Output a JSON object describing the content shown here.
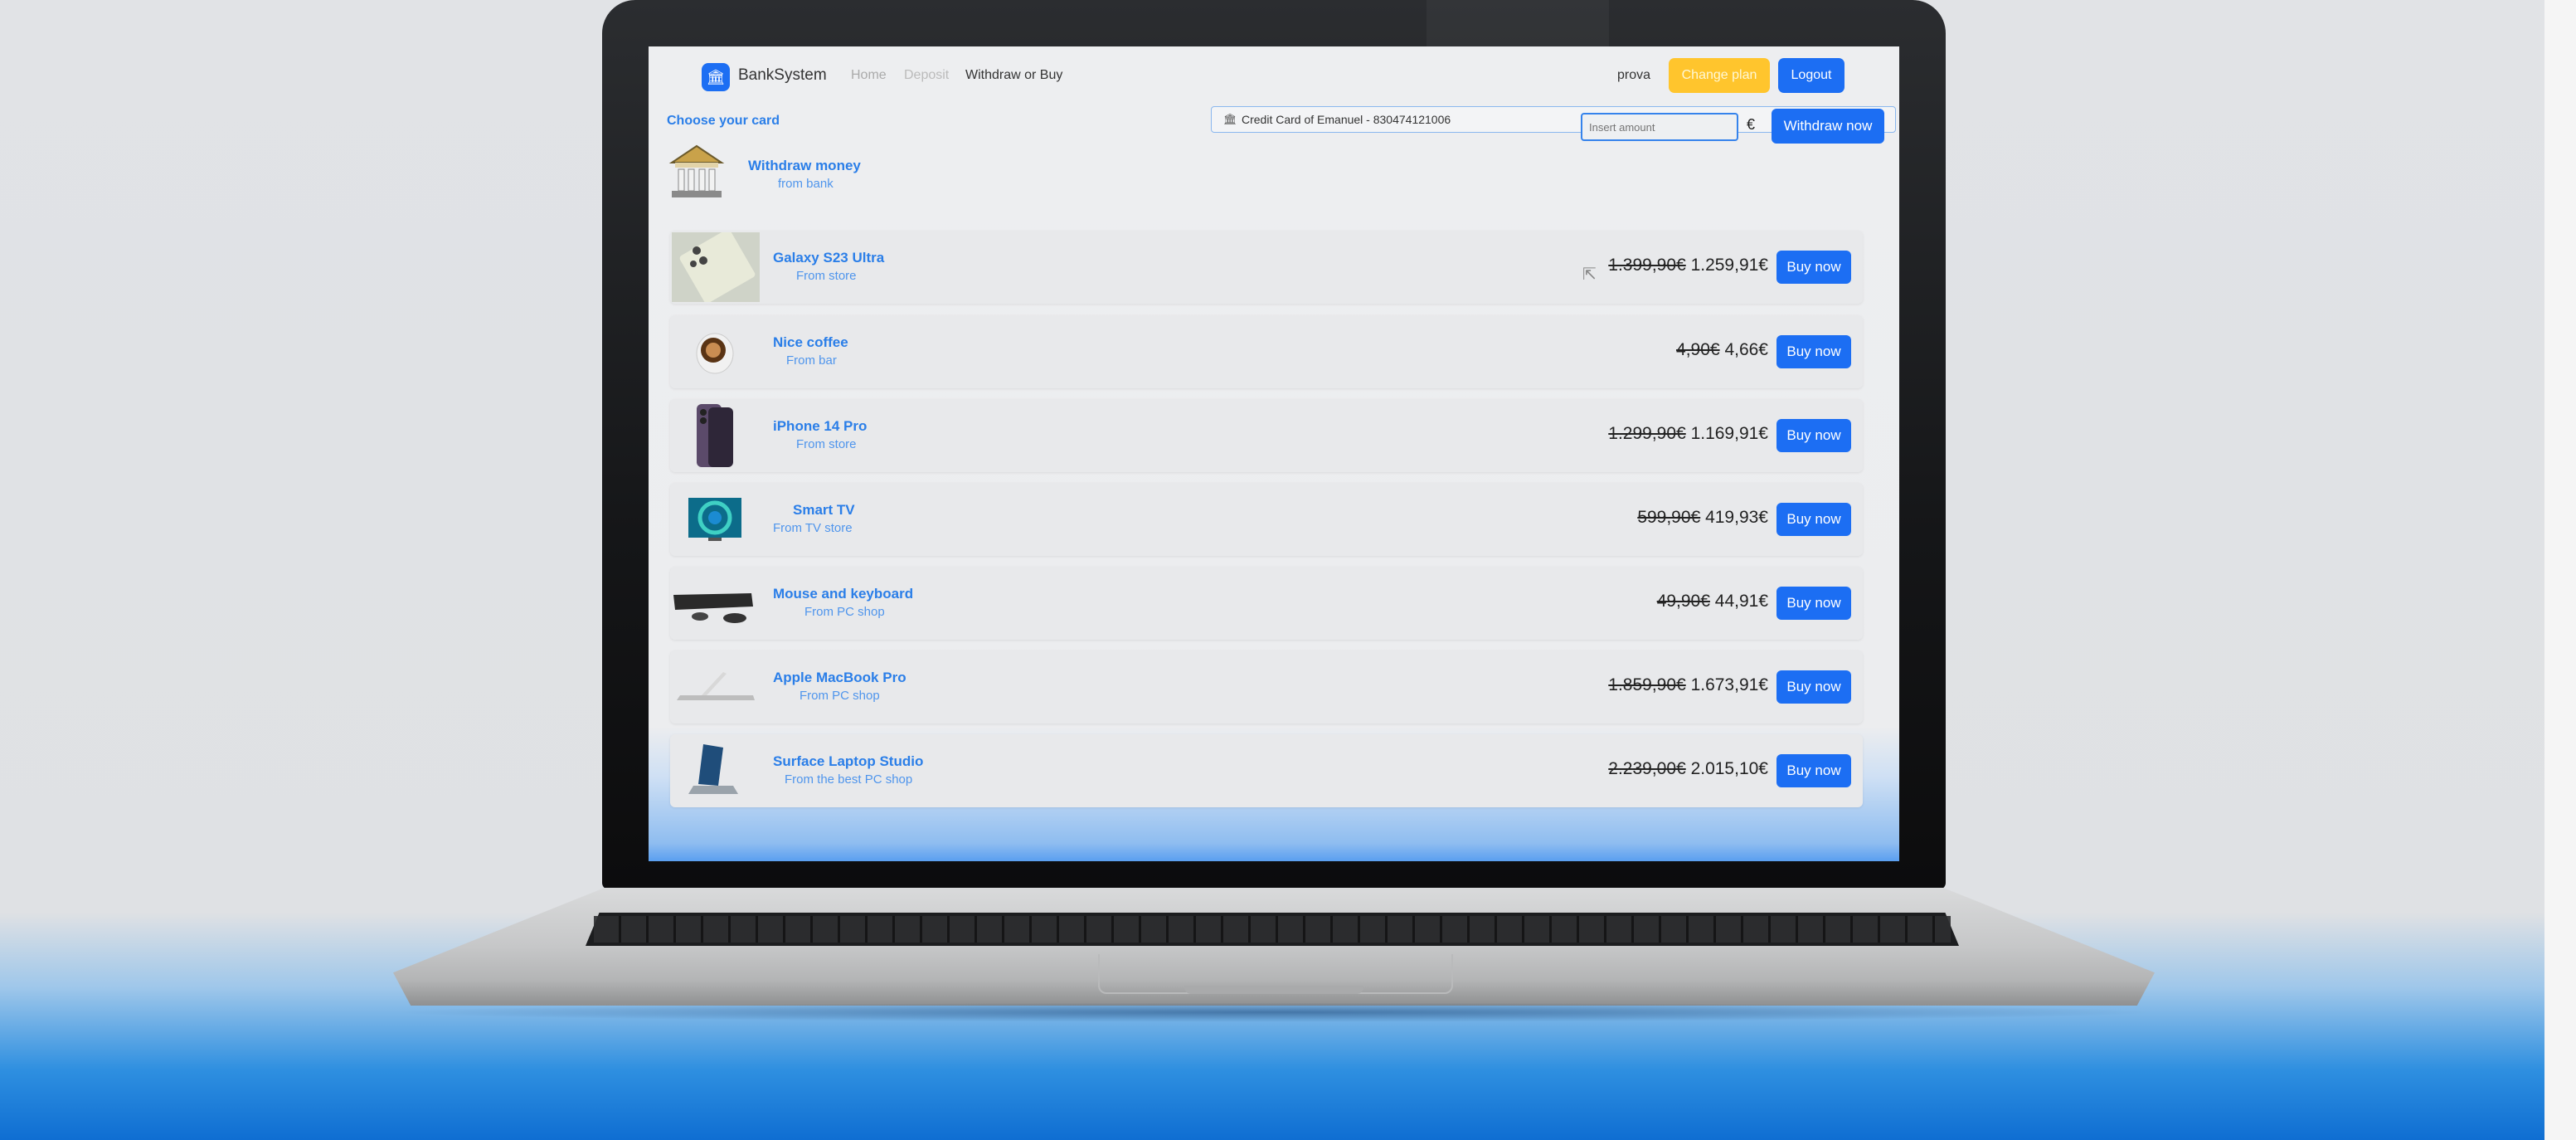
{
  "navbar": {
    "brand": "BankSystem",
    "links": [
      "Home",
      "Deposit",
      "Withdraw or Buy"
    ],
    "link_colors": [
      "#aaaaaa",
      "#bbbbbb",
      "#333333"
    ],
    "user": "prova",
    "change_plan_label": "Change plan",
    "logout_label": "Logout"
  },
  "card_chooser": {
    "label": "Choose your card",
    "selected": "Credit Card of Emanuel - 830474121006"
  },
  "withdraw": {
    "title": "Withdraw money",
    "subtitle": "from bank",
    "amount_placeholder": "Insert amount",
    "currency": "€",
    "button_label": "Withdraw now"
  },
  "products": [
    {
      "name": "Galaxy S23 Ultra",
      "from": "From store",
      "old_price": "1.399,90€",
      "price": "1.259,91€",
      "button": "Buy now",
      "icon": "phone-image"
    },
    {
      "name": "Nice coffee",
      "from": "From bar",
      "old_price": "4,90€",
      "price": "4,66€",
      "button": "Buy now",
      "icon": "coffee-image"
    },
    {
      "name": "iPhone 14 Pro",
      "from": "From store",
      "old_price": "1.299,90€",
      "price": "1.169,91€",
      "button": "Buy now",
      "icon": "phone-image"
    },
    {
      "name": "Smart TV",
      "from": "From TV store",
      "old_price": "599,90€",
      "price": "419,93€",
      "button": "Buy now",
      "icon": "tv-image"
    },
    {
      "name": "Mouse and keyboard",
      "from": "From PC shop",
      "old_price": "49,90€",
      "price": "44,91€",
      "button": "Buy now",
      "icon": "keyboard-image"
    },
    {
      "name": "Apple MacBook Pro",
      "from": "From PC shop",
      "old_price": "1.859,90€",
      "price": "1.673,91€",
      "button": "Buy now",
      "icon": "laptop-image"
    },
    {
      "name": "Surface Laptop Studio",
      "from": "From the best PC shop",
      "old_price": "2.239,00€",
      "price": "2.015,10€",
      "button": "Buy now",
      "icon": "laptop-image"
    }
  ],
  "colors": {
    "primary": "#1c6ef3",
    "warning": "#ffc52d",
    "link_blue": "#2a7ee8"
  }
}
